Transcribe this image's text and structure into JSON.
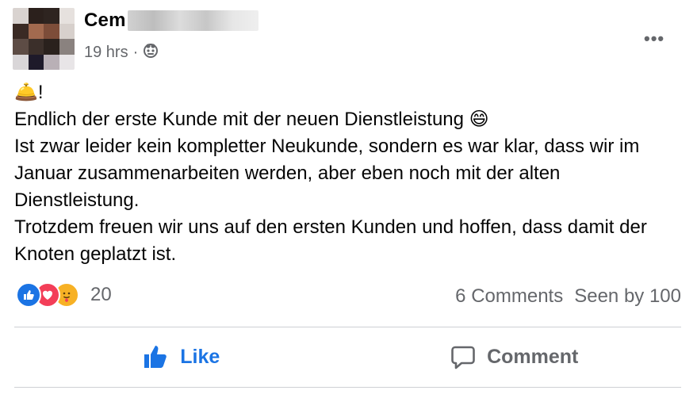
{
  "post": {
    "author_name": "Cem",
    "timestamp": "19 hrs",
    "separator": "·",
    "audience_icon": "friends-icon",
    "more_label": "•••",
    "body_lines": [
      "🛎️!",
      "Endlich der erste Kunde mit der neuen Dienstleistung 😄",
      "Ist zwar leider kein kompletter Neukunde, sondern es war klar, dass wir im Januar zusammenarbeiten werden, aber eben noch mit der alten Dienstleistung.",
      "Trotzdem freuen wir uns auf den ersten Kunden und hoffen, dass damit der Knoten geplatzt ist."
    ]
  },
  "reactions": {
    "icons": [
      "like-icon",
      "love-icon",
      "care-icon"
    ],
    "count": "20",
    "comments": "6 Comments",
    "seen_by": "Seen by 100"
  },
  "actions": {
    "like_label": "Like",
    "comment_label": "Comment"
  },
  "colors": {
    "accent": "#1b74e4",
    "secondary_text": "#65676b",
    "love": "#f33e58",
    "care": "#f7b125",
    "divider": "#ced0d4"
  }
}
